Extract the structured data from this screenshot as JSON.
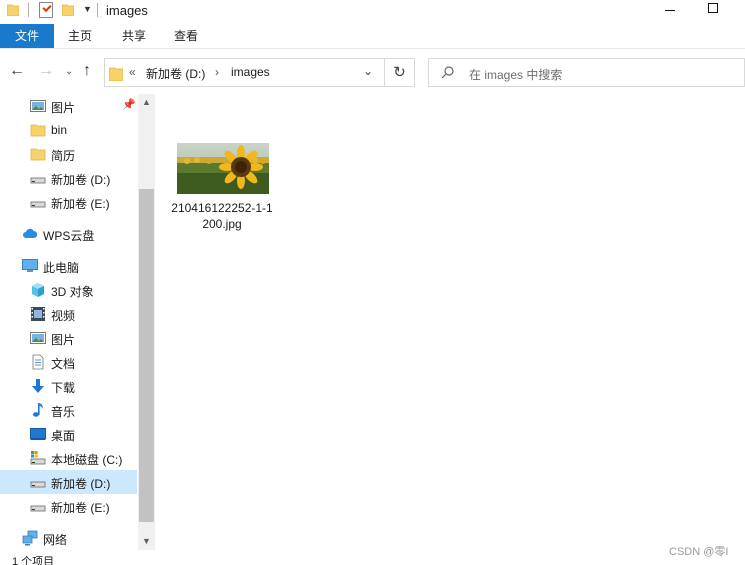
{
  "window": {
    "title": "images"
  },
  "ribbon": {
    "tabs": [
      "文件",
      "主页",
      "共享",
      "查看"
    ]
  },
  "address": {
    "overflow_chevron": "«",
    "segments": [
      "新加卷 (D:)",
      "images"
    ]
  },
  "search": {
    "placeholder": "在 images 中搜索"
  },
  "sidebar": {
    "items": [
      {
        "label": "图片",
        "icon": "pictures-icon",
        "pinned": true
      },
      {
        "label": "bin",
        "icon": "folder-icon"
      },
      {
        "label": "简历",
        "icon": "folder-icon"
      },
      {
        "label": "新加卷 (D:)",
        "icon": "drive-icon"
      },
      {
        "label": "新加卷 (E:)",
        "icon": "drive-icon"
      },
      {
        "label": "WPS云盘",
        "icon": "cloud-icon"
      },
      {
        "label": "此电脑",
        "icon": "computer-icon"
      },
      {
        "label": "3D 对象",
        "icon": "3d-objects-icon"
      },
      {
        "label": "视频",
        "icon": "videos-icon"
      },
      {
        "label": "图片",
        "icon": "pictures-icon"
      },
      {
        "label": "文档",
        "icon": "documents-icon"
      },
      {
        "label": "下载",
        "icon": "downloads-icon"
      },
      {
        "label": "音乐",
        "icon": "music-icon"
      },
      {
        "label": "桌面",
        "icon": "desktop-icon"
      },
      {
        "label": "本地磁盘 (C:)",
        "icon": "system-drive-icon"
      },
      {
        "label": "新加卷 (D:)",
        "icon": "drive-icon",
        "selected": true
      },
      {
        "label": "新加卷 (E:)",
        "icon": "drive-icon"
      },
      {
        "label": "网络",
        "icon": "network-icon"
      }
    ]
  },
  "files": [
    {
      "name": "210416122252-1-1200.jpg",
      "thumbnail": "sunflower-thumbnail"
    }
  ],
  "status": {
    "item_count": "1 个项目"
  },
  "watermark": "CSDN @零I",
  "colors": {
    "accent": "#1979ca",
    "selected": "#cce8ff"
  }
}
